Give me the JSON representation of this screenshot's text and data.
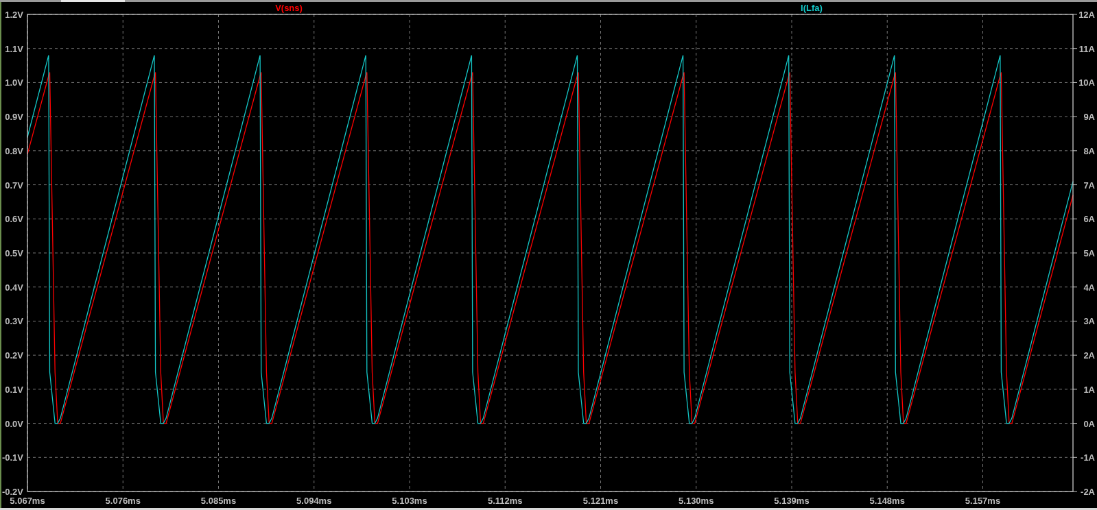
{
  "chart_data": {
    "type": "line",
    "grid": true,
    "x": [
      5.067,
      5.069,
      5.0691,
      5.0696,
      5.06985,
      5.0701,
      5.07896,
      5.07906,
      5.07956,
      5.07981,
      5.08006,
      5.08892,
      5.08902,
      5.08952,
      5.08977,
      5.09002,
      5.09888,
      5.09898,
      5.09948,
      5.09973,
      5.09998,
      5.10884,
      5.10894,
      5.10944,
      5.10969,
      5.10994,
      5.1188,
      5.1189,
      5.1194,
      5.11965,
      5.1199,
      5.12876,
      5.12886,
      5.12936,
      5.12961,
      5.12986,
      5.13872,
      5.13882,
      5.13932,
      5.13957,
      5.13982,
      5.14868,
      5.14878,
      5.14928,
      5.14953,
      5.14978,
      5.15864,
      5.15874,
      5.15924,
      5.15949,
      5.15974,
      5.1655
    ],
    "xlim": [
      5.067,
      5.1655
    ],
    "xticks": [
      {
        "value": 5.067,
        "label": "5.067ms"
      },
      {
        "value": 5.076,
        "label": "5.076ms"
      },
      {
        "value": 5.085,
        "label": "5.085ms"
      },
      {
        "value": 5.094,
        "label": "5.094ms"
      },
      {
        "value": 5.103,
        "label": "5.103ms"
      },
      {
        "value": 5.112,
        "label": "5.112ms"
      },
      {
        "value": 5.121,
        "label": "5.121ms"
      },
      {
        "value": 5.13,
        "label": "5.130ms"
      },
      {
        "value": 5.139,
        "label": "5.139ms"
      },
      {
        "value": 5.148,
        "label": "5.148ms"
      },
      {
        "value": 5.157,
        "label": "5.157ms"
      }
    ],
    "ylim": [
      -0.2,
      1.2
    ],
    "yticks": [
      {
        "value": 1.2,
        "label": "1.2V"
      },
      {
        "value": 1.1,
        "label": "1.1V"
      },
      {
        "value": 1.0,
        "label": "1.0V"
      },
      {
        "value": 0.9,
        "label": "0.9V"
      },
      {
        "value": 0.8,
        "label": "0.8V"
      },
      {
        "value": 0.7,
        "label": "0.7V"
      },
      {
        "value": 0.6,
        "label": "0.6V"
      },
      {
        "value": 0.5,
        "label": "0.5V"
      },
      {
        "value": 0.4,
        "label": "0.4V"
      },
      {
        "value": 0.3,
        "label": "0.3V"
      },
      {
        "value": 0.2,
        "label": "0.2V"
      },
      {
        "value": 0.1,
        "label": "0.1V"
      },
      {
        "value": 0.0,
        "label": "0.0V"
      },
      {
        "value": -0.1,
        "label": "-0.1V"
      },
      {
        "value": -0.2,
        "label": "-0.2V"
      }
    ],
    "y2lim": [
      -2,
      12
    ],
    "y2ticks": [
      {
        "value": 12,
        "label": "12A"
      },
      {
        "value": 11,
        "label": "11A"
      },
      {
        "value": 10,
        "label": "10A"
      },
      {
        "value": 9,
        "label": "9A"
      },
      {
        "value": 8,
        "label": "8A"
      },
      {
        "value": 7,
        "label": "7A"
      },
      {
        "value": 6,
        "label": "6A"
      },
      {
        "value": 5,
        "label": "5A"
      },
      {
        "value": 4,
        "label": "4A"
      },
      {
        "value": 3,
        "label": "3A"
      },
      {
        "value": 2,
        "label": "2A"
      },
      {
        "value": 1,
        "label": "1A"
      },
      {
        "value": 0,
        "label": "0A"
      },
      {
        "value": -1,
        "label": "-1A"
      },
      {
        "value": -2,
        "label": "-2A"
      }
    ],
    "series": [
      {
        "name": "V(sns)",
        "color": "#ff0000",
        "axis": "y",
        "values": [
          0.79,
          1.02,
          1.03,
          0.15,
          0,
          0,
          1.02,
          1.03,
          0.15,
          0,
          0,
          1.02,
          1.03,
          0.15,
          0,
          0,
          1.02,
          1.03,
          0.15,
          0,
          0,
          1.02,
          1.03,
          0.15,
          0,
          0,
          1.02,
          1.03,
          0.15,
          0,
          0,
          1.02,
          1.03,
          0.15,
          0,
          0,
          1.02,
          1.03,
          0.15,
          0,
          0,
          1.02,
          1.03,
          0.15,
          0,
          0,
          1.02,
          1.03,
          0.15,
          0,
          0,
          0.67
        ]
      },
      {
        "name": "I(Lfa)",
        "color": "#14c8c8",
        "axis": "y2",
        "values": [
          8.4,
          10.8,
          1.5,
          0,
          0,
          0.15,
          10.8,
          1.5,
          0,
          0,
          0.15,
          10.8,
          1.5,
          0,
          0,
          0.15,
          10.8,
          1.5,
          0,
          0,
          0.15,
          10.8,
          1.5,
          0,
          0,
          0.15,
          10.8,
          1.5,
          0,
          0,
          0.15,
          10.8,
          1.5,
          0,
          0,
          0.15,
          10.8,
          1.5,
          0,
          0,
          0.15,
          10.8,
          1.5,
          0,
          0,
          0.15,
          10.8,
          1.5,
          0,
          0,
          0.15,
          7.1
        ]
      }
    ]
  }
}
